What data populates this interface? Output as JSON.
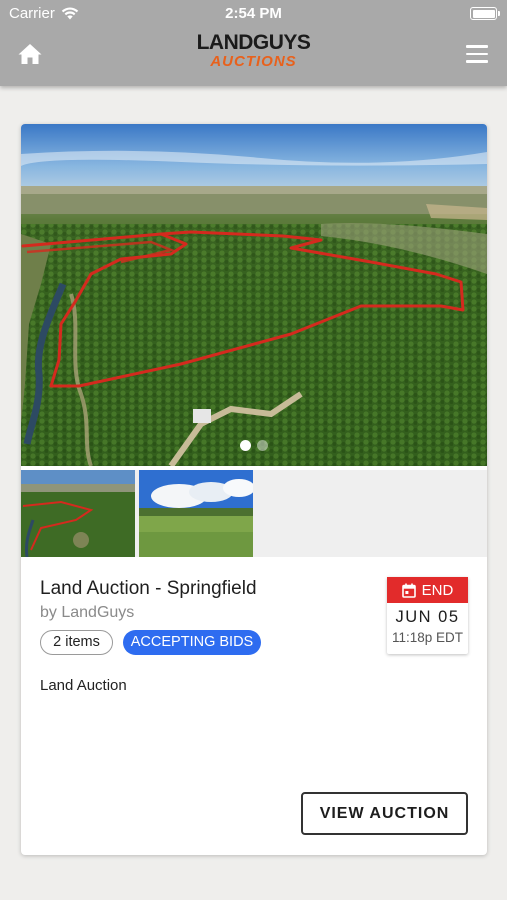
{
  "status_bar": {
    "carrier": "Carrier",
    "time": "2:54 PM",
    "wifi_icon": "wifi-icon",
    "battery_icon": "battery-icon"
  },
  "header": {
    "home_icon": "home-icon",
    "menu_icon": "hamburger-menu-icon",
    "logo_line1": "LANDGUYS",
    "logo_line2": "AUCTIONS",
    "logo_line2_color": "#e8611c",
    "background": "#a9a9a9"
  },
  "auction": {
    "title": "Land Auction - Springfield",
    "byline": "by LandGuys",
    "items_badge": "2 items",
    "status_badge": "ACCEPTING BIDS",
    "status_color": "#2e6cf0",
    "description": "Land Auction",
    "end": {
      "label": "END",
      "icon": "calendar-icon",
      "date": "JUN 05",
      "time": "11:18p EDT",
      "color": "#e22b2b"
    },
    "carousel": {
      "image_count": 2,
      "active_index": 0
    },
    "thumbnails": [
      "aerial-orchard-photo",
      "green-field-photo"
    ],
    "view_button_label": "VIEW AUCTION"
  }
}
